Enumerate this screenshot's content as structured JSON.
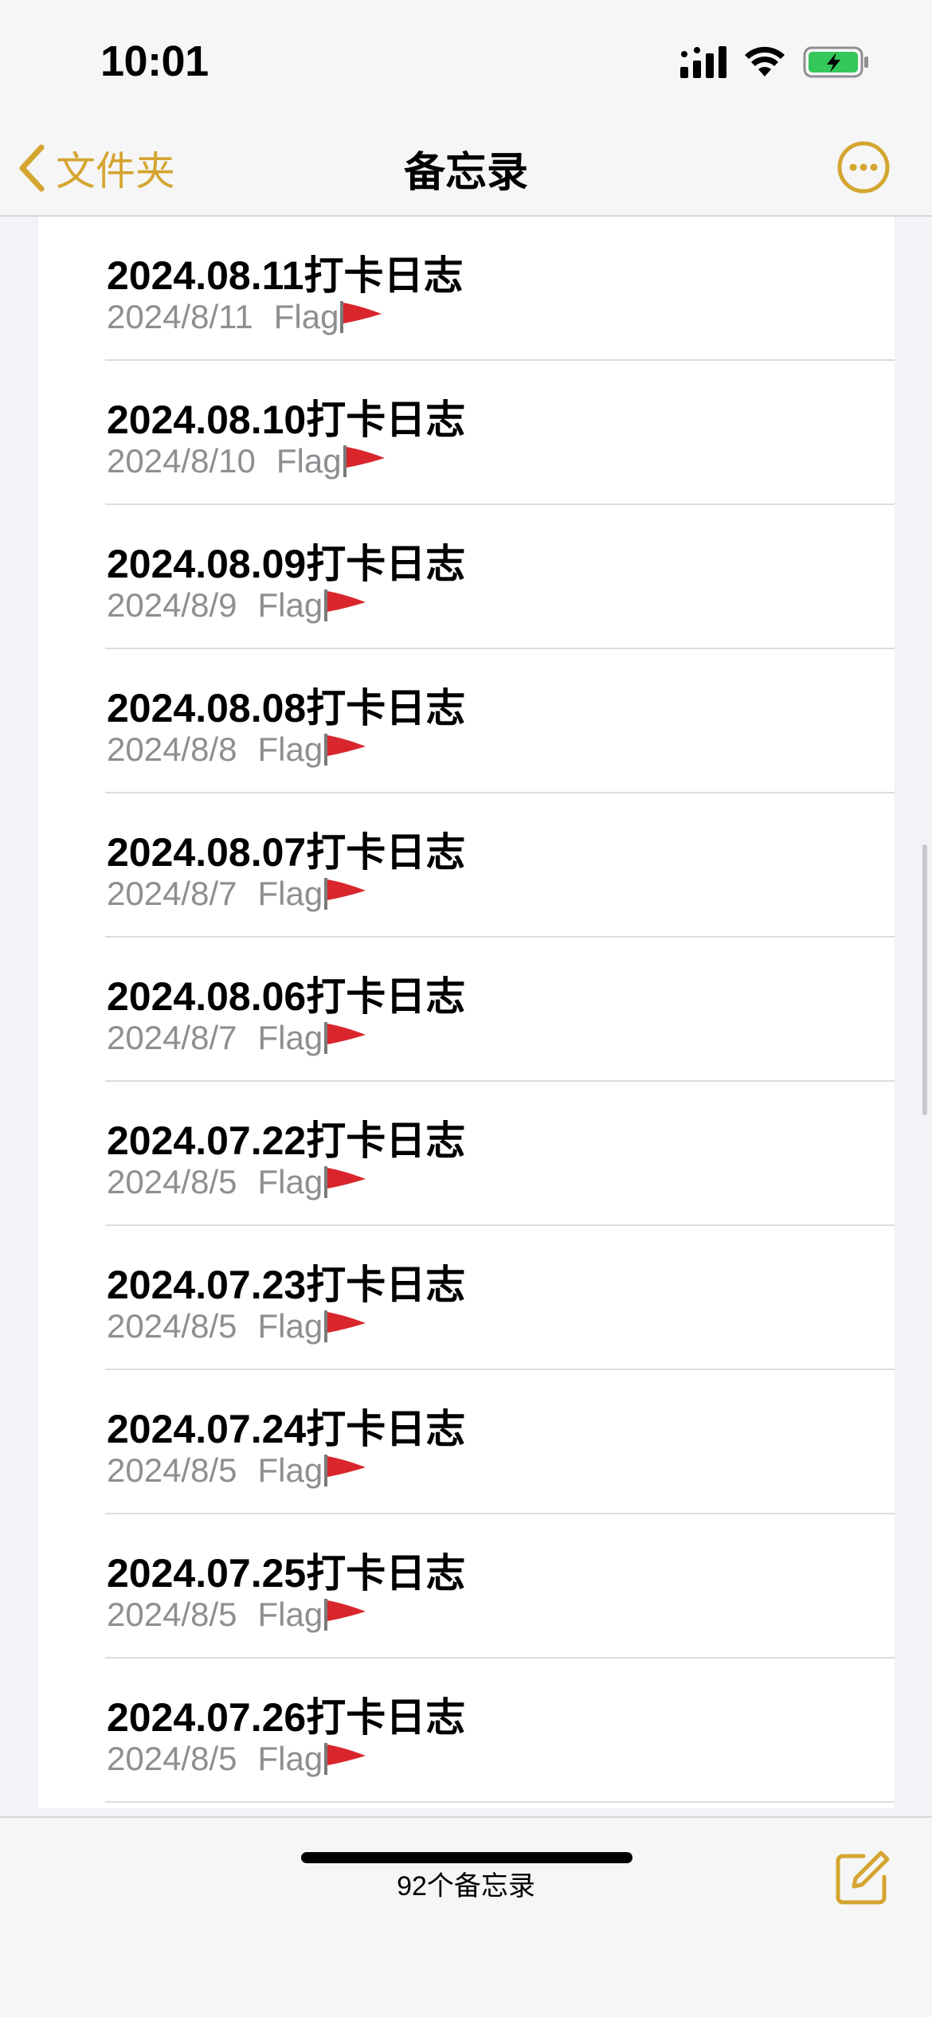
{
  "status_bar": {
    "time": "10:01"
  },
  "nav": {
    "back_label": "文件夹",
    "title": "备忘录"
  },
  "notes": [
    {
      "title": "2024.08.11打卡日志",
      "date": "2024/8/11",
      "preview": "Flag"
    },
    {
      "title": "2024.08.10打卡日志",
      "date": "2024/8/10",
      "preview": "Flag"
    },
    {
      "title": "2024.08.09打卡日志",
      "date": "2024/8/9",
      "preview": "Flag"
    },
    {
      "title": "2024.08.08打卡日志",
      "date": "2024/8/8",
      "preview": "Flag"
    },
    {
      "title": "2024.08.07打卡日志",
      "date": "2024/8/7",
      "preview": "Flag"
    },
    {
      "title": "2024.08.06打卡日志",
      "date": "2024/8/7",
      "preview": "Flag"
    },
    {
      "title": "2024.07.22打卡日志",
      "date": "2024/8/5",
      "preview": "Flag"
    },
    {
      "title": "2024.07.23打卡日志",
      "date": "2024/8/5",
      "preview": "Flag"
    },
    {
      "title": "2024.07.24打卡日志",
      "date": "2024/8/5",
      "preview": "Flag"
    },
    {
      "title": "2024.07.25打卡日志",
      "date": "2024/8/5",
      "preview": "Flag"
    },
    {
      "title": "2024.07.26打卡日志",
      "date": "2024/8/5",
      "preview": "Flag"
    }
  ],
  "toolbar": {
    "count_label": "92个备忘录"
  },
  "icons": {
    "back": "chevron-left-icon",
    "more": "ellipsis-circle-icon",
    "compose": "compose-icon",
    "flag": "red-flag-icon"
  },
  "colors": {
    "accent": "#d4a531",
    "battery": "#34c759",
    "flag": "#d9262c"
  }
}
